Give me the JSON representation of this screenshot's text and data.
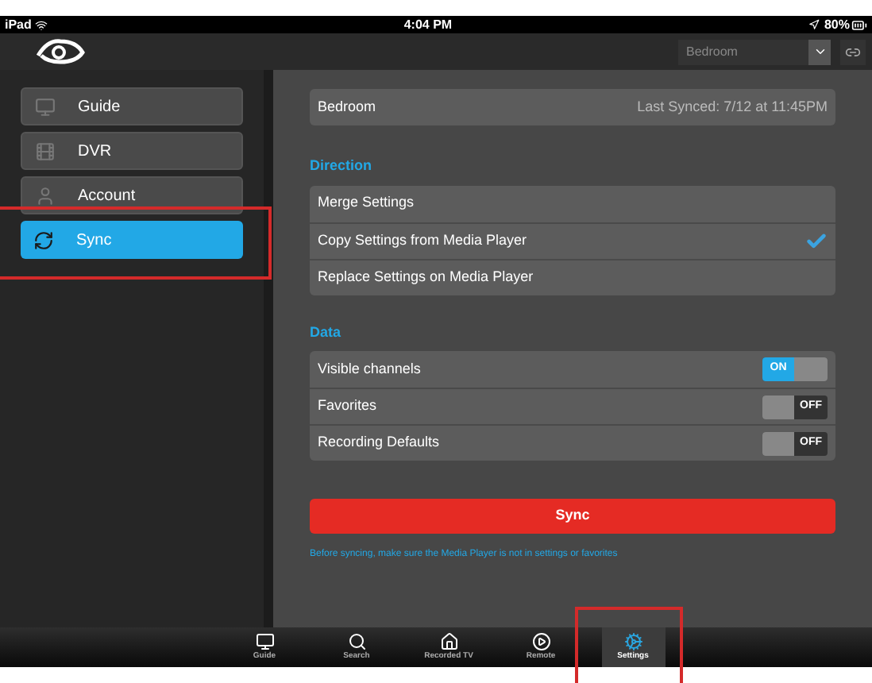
{
  "status_bar": {
    "device": "iPad",
    "time": "4:04 PM",
    "battery": "80%"
  },
  "header": {
    "room_select": "Bedroom"
  },
  "sidebar": {
    "items": [
      {
        "label": "Guide",
        "selected": false
      },
      {
        "label": "DVR",
        "selected": false
      },
      {
        "label": "Account",
        "selected": false
      },
      {
        "label": "Sync",
        "selected": true
      }
    ]
  },
  "device_card": {
    "name": "Bedroom",
    "last_synced": "Last Synced: 7/12 at 11:45PM"
  },
  "direction": {
    "heading": "Direction",
    "options": [
      {
        "label": "Merge Settings",
        "selected": false
      },
      {
        "label": "Copy Settings from Media Player",
        "selected": true
      },
      {
        "label": "Replace Settings on Media Player",
        "selected": false
      }
    ]
  },
  "data": {
    "heading": "Data",
    "toggles": [
      {
        "label": "Visible channels",
        "on": true,
        "switch_text": "ON"
      },
      {
        "label": "Favorites",
        "on": false,
        "switch_text": "OFF"
      },
      {
        "label": "Recording Defaults",
        "on": false,
        "switch_text": "OFF"
      }
    ]
  },
  "sync_button": "Sync",
  "note": "Before syncing, make sure the Media Player is not in settings or favorites",
  "tab_bar": [
    {
      "label": "Guide",
      "selected": false
    },
    {
      "label": "Search",
      "selected": false
    },
    {
      "label": "Recorded TV",
      "selected": false
    },
    {
      "label": "Remote",
      "selected": false
    },
    {
      "label": "Settings",
      "selected": true
    }
  ]
}
